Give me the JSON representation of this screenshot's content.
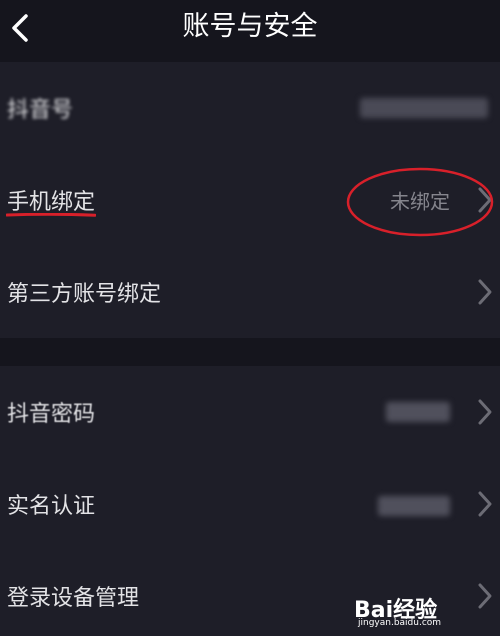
{
  "header": {
    "title": "账号与安全",
    "back_icon": "chevron-left-icon"
  },
  "group1": {
    "rows": [
      {
        "label": "抖音号",
        "value": "",
        "obscured": true
      },
      {
        "label": "手机绑定",
        "value": "未绑定"
      },
      {
        "label": "第三方账号绑定",
        "value": ""
      }
    ]
  },
  "group2": {
    "rows": [
      {
        "label": "抖音密码",
        "value": "",
        "obscured": true
      },
      {
        "label": "实名认证",
        "value": "",
        "obscured": true
      },
      {
        "label": "登录设备管理",
        "value": ""
      }
    ]
  },
  "annotations": {
    "underline_color": "#d8202a",
    "circle_color": "#d8202a"
  },
  "watermark": {
    "logo": "Bai经验",
    "site": "jingyan.baidu.com"
  },
  "colors": {
    "background": "#15151d",
    "row_background": "#1e1e28",
    "text": "#e3e3e6",
    "secondary_text": "#85858d"
  }
}
